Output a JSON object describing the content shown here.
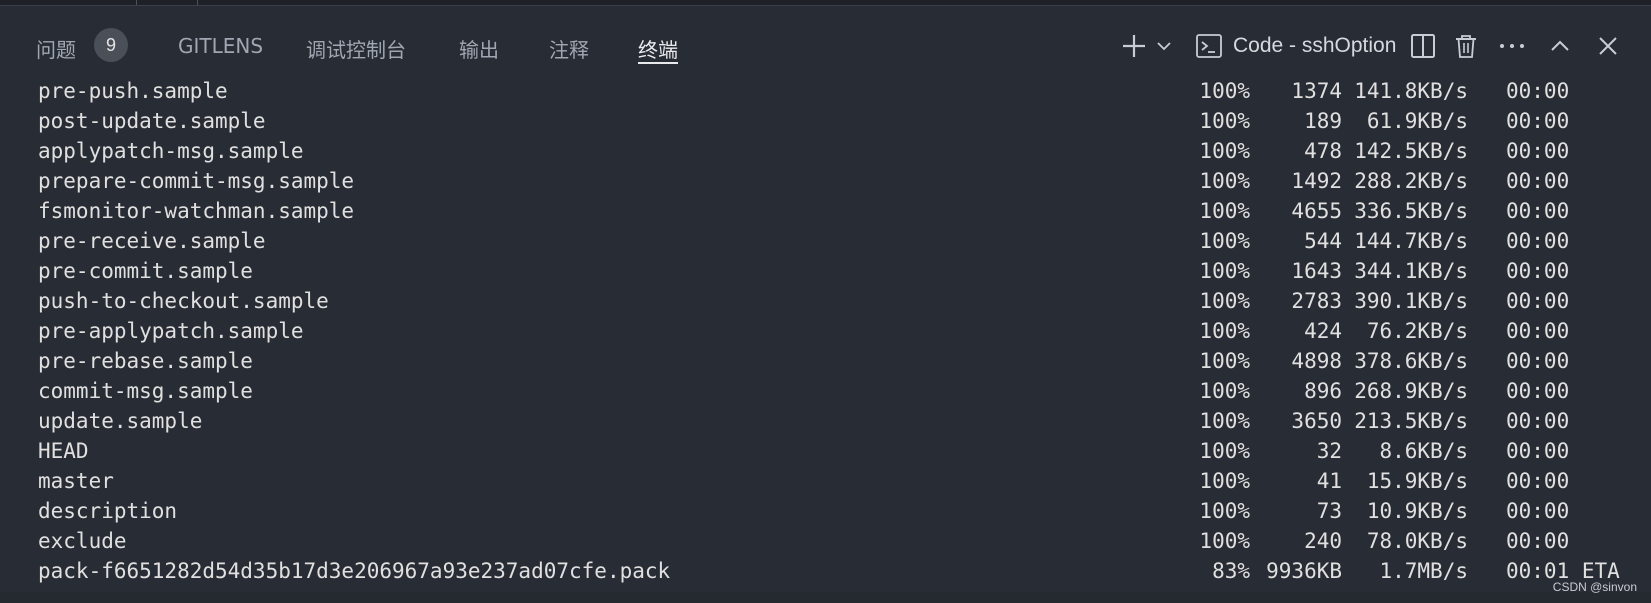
{
  "panel": {
    "tabs": [
      {
        "label": "问题",
        "badge": "9"
      },
      {
        "label": "GITLENS"
      },
      {
        "label": "调试控制台"
      },
      {
        "label": "输出"
      },
      {
        "label": "注释"
      },
      {
        "label": "终端",
        "active": true
      }
    ],
    "terminal_name": "Code - sshOption",
    "icons": {
      "new_terminal": "plus-icon",
      "dropdown": "chevron-down-icon",
      "terminal": "terminal-icon",
      "split": "split-editor-icon",
      "kill": "trash-icon",
      "more": "more-icon",
      "maximize": "chevron-up-icon",
      "close": "close-icon"
    }
  },
  "terminal": {
    "rows": [
      {
        "name": "pre-push.sample",
        "pct": "100%",
        "size": "1374",
        "rate": "141.8KB/s",
        "eta": "00:00"
      },
      {
        "name": "post-update.sample",
        "pct": "100%",
        "size": "189",
        "rate": "61.9KB/s",
        "eta": "00:00"
      },
      {
        "name": "applypatch-msg.sample",
        "pct": "100%",
        "size": "478",
        "rate": "142.5KB/s",
        "eta": "00:00"
      },
      {
        "name": "prepare-commit-msg.sample",
        "pct": "100%",
        "size": "1492",
        "rate": "288.2KB/s",
        "eta": "00:00"
      },
      {
        "name": "fsmonitor-watchman.sample",
        "pct": "100%",
        "size": "4655",
        "rate": "336.5KB/s",
        "eta": "00:00"
      },
      {
        "name": "pre-receive.sample",
        "pct": "100%",
        "size": "544",
        "rate": "144.7KB/s",
        "eta": "00:00"
      },
      {
        "name": "pre-commit.sample",
        "pct": "100%",
        "size": "1643",
        "rate": "344.1KB/s",
        "eta": "00:00"
      },
      {
        "name": "push-to-checkout.sample",
        "pct": "100%",
        "size": "2783",
        "rate": "390.1KB/s",
        "eta": "00:00"
      },
      {
        "name": "pre-applypatch.sample",
        "pct": "100%",
        "size": "424",
        "rate": "76.2KB/s",
        "eta": "00:00"
      },
      {
        "name": "pre-rebase.sample",
        "pct": "100%",
        "size": "4898",
        "rate": "378.6KB/s",
        "eta": "00:00"
      },
      {
        "name": "commit-msg.sample",
        "pct": "100%",
        "size": "896",
        "rate": "268.9KB/s",
        "eta": "00:00"
      },
      {
        "name": "update.sample",
        "pct": "100%",
        "size": "3650",
        "rate": "213.5KB/s",
        "eta": "00:00"
      },
      {
        "name": "HEAD",
        "pct": "100%",
        "size": "32",
        "rate": "8.6KB/s",
        "eta": "00:00"
      },
      {
        "name": "master",
        "pct": "100%",
        "size": "41",
        "rate": "15.9KB/s",
        "eta": "00:00"
      },
      {
        "name": "description",
        "pct": "100%",
        "size": "73",
        "rate": "10.9KB/s",
        "eta": "00:00"
      },
      {
        "name": "exclude",
        "pct": "100%",
        "size": "240",
        "rate": "78.0KB/s",
        "eta": "00:00"
      },
      {
        "name": "pack-f6651282d54d35b17d3e206967a93e237ad07cfe.pack",
        "pct": "83%",
        "size": "9936KB",
        "rate": "1.7MB/s",
        "eta": "00:01 ETA"
      }
    ]
  },
  "watermark": "CSDN @sinvon"
}
